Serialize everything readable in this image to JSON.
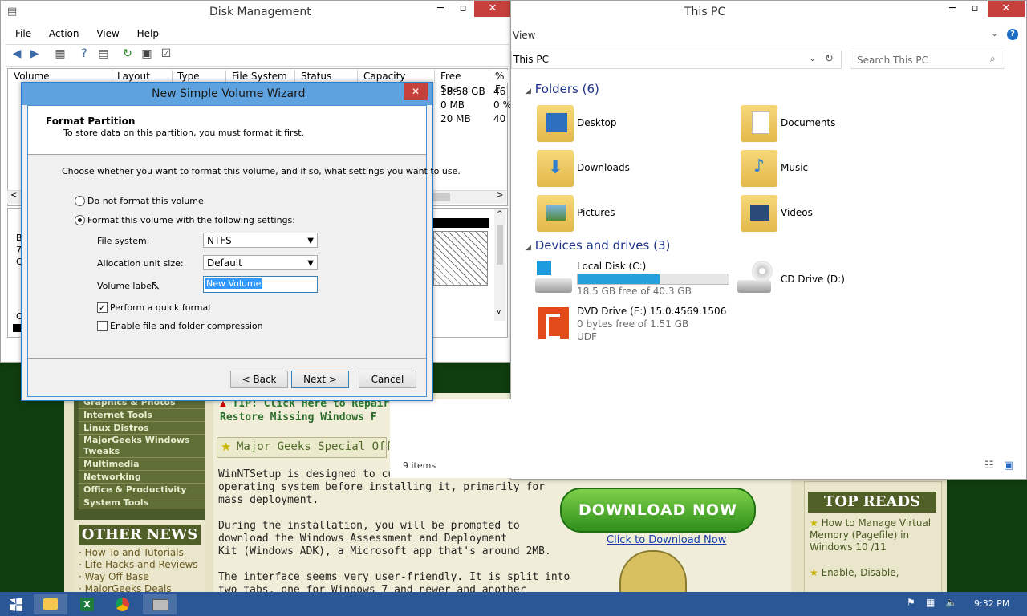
{
  "web": {
    "categories": [
      "Graphics & Photos",
      "Internet Tools",
      "Linux Distros",
      "MajorGeeks Windows Tweaks",
      "Multimedia",
      "Networking",
      "Office & Productivity",
      "System Tools"
    ],
    "other_news_title": "OTHER NEWS",
    "other_news_links": [
      "How To and Tutorials",
      "Life Hacks and Reviews",
      "Way Off Base",
      "MajorGeeks Deals"
    ],
    "tip_line1": "TIP: Click Here to Repair",
    "tip_line2": "Restore Missing Windows F",
    "special_offer": "Major Geeks Special Offer",
    "body_lines": [
      "WinNTSetup is designed to cus",
      "operating system before installing it, primarily for",
      "mass deployment.",
      "",
      "During the installation, you will be prompted to",
      "download the Windows Assessment and Deployment",
      "Kit (Windows ADK), a Microsoft app that's around 2MB.",
      "",
      "The interface seems very user-friendly. It is split into",
      "two tabs, one for Windows 7 and newer and another"
    ],
    "download_button": "DOWNLOAD NOW",
    "download_link": "Click to Download Now",
    "top_reads_title": "TOP READS",
    "top_reads": [
      "How to Manage Virtual Memory (Pagefile) in Windows 10 /11",
      "Enable, Disable,"
    ]
  },
  "disk_mgmt": {
    "title": "Disk Management",
    "menu": [
      "File",
      "Action",
      "View",
      "Help"
    ],
    "columns": [
      "Volume",
      "Layout",
      "Type",
      "File System",
      "Status",
      "Capacity",
      "Free Spa...",
      "% F"
    ],
    "free_space": [
      "18.58 GB",
      "0 MB",
      "20 MB"
    ],
    "percent_free": [
      "46",
      "0 %",
      "40"
    ],
    "disk_labels": [
      "B",
      "7",
      "O"
    ],
    "disk_labels2": [
      "C"
    ]
  },
  "this_pc": {
    "title": "This PC",
    "ribbon_view": "View",
    "address": "This PC",
    "search_placeholder": "Search This PC",
    "folders_header": "Folders (6)",
    "folders": [
      "Desktop",
      "Documents",
      "Downloads",
      "Music",
      "Pictures",
      "Videos"
    ],
    "devices_header": "Devices and drives (3)",
    "local_disk": {
      "name": "Local Disk (C:)",
      "free": "18.5 GB free of 40.3 GB",
      "used_fraction": 0.54
    },
    "cd_drive": {
      "name": "CD Drive (D:)"
    },
    "dvd_drive": {
      "name": "DVD Drive (E:) 15.0.4569.1506",
      "free": "0 bytes free of 1.51 GB",
      "fs": "UDF"
    },
    "status": "9 items"
  },
  "wizard": {
    "title": "New Simple Volume Wizard",
    "heading": "Format Partition",
    "subheading": "To store data on this partition, you must format it first.",
    "instruction": "Choose whether you want to format this volume, and if so, what settings you want to use.",
    "option_no_format": "Do not format this volume",
    "option_format": "Format this volume with the following settings:",
    "fs_label": "File system:",
    "fs_value": "NTFS",
    "alloc_label": "Allocation unit size:",
    "alloc_value": "Default",
    "vol_label": "Volume label:",
    "vol_value": "New Volume",
    "quick_format": "Perform a quick format",
    "compression": "Enable file and folder compression",
    "back": "< Back",
    "next": "Next >",
    "cancel": "Cancel"
  },
  "taskbar": {
    "clock": "9:32 PM"
  }
}
